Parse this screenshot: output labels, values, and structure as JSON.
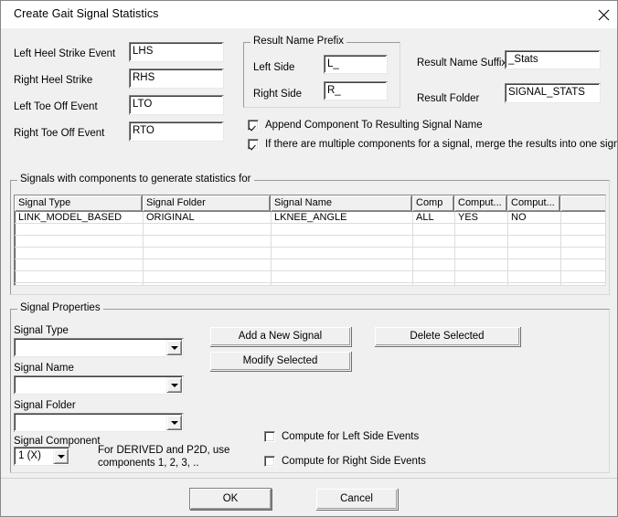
{
  "window": {
    "title": "Create Gait Signal Statistics",
    "close_icon": "close-icon"
  },
  "events": {
    "fields": [
      {
        "label": "Left Heel Strike Event",
        "value": "LHS"
      },
      {
        "label": "Right Heel Strike",
        "value": "RHS"
      },
      {
        "label": "Left Toe Off Event",
        "value": "LTO"
      },
      {
        "label": "Right Toe Off Event",
        "value": "RTO"
      }
    ]
  },
  "result_name_prefix": {
    "title": "Result Name Prefix",
    "left_label": "Left Side",
    "left_value": "L_",
    "right_label": "Right Side",
    "right_value": "R_"
  },
  "result": {
    "suffix_label": "Result Name Suffix",
    "suffix_value": "_Stats",
    "folder_label": "Result Folder",
    "folder_value": "SIGNAL_STATS"
  },
  "options": {
    "append_component": {
      "label": "Append Component To Resulting Signal Name",
      "checked": true
    },
    "merge_components": {
      "label": "If there are multiple components for a signal, merge the results into one signal",
      "checked": true
    }
  },
  "signals_group": {
    "title": "Signals with components to generate statistics for",
    "columns": [
      "Signal Type",
      "Signal Folder",
      "Signal Name",
      "Comp",
      "Comput...",
      "Comput...",
      ""
    ],
    "rows": [
      [
        "LINK_MODEL_BASED",
        "ORIGINAL",
        "LKNEE_ANGLE",
        "ALL",
        "YES",
        "NO",
        ""
      ]
    ],
    "empty_row_count": 6
  },
  "signal_properties": {
    "title": "Signal Properties",
    "signal_type_label": "Signal Type",
    "signal_type_value": "",
    "signal_name_label": "Signal Name",
    "signal_name_value": "",
    "signal_folder_label": "Signal Folder",
    "signal_folder_value": "",
    "signal_component_label": "Signal Component",
    "signal_component_value": "1 (X)",
    "hint_line1": "For DERIVED and P2D, use",
    "hint_line2": "components 1, 2, 3, ..",
    "add_button": "Add a New Signal",
    "modify_button": "Modify Selected",
    "delete_button": "Delete Selected",
    "compute_left": {
      "label": "Compute for Left Side Events",
      "checked": false
    },
    "compute_right": {
      "label": "Compute for Right Side Events",
      "checked": false
    }
  },
  "footer": {
    "ok_label": "OK",
    "cancel_label": "Cancel"
  },
  "colors": {
    "dialog_bg": "#f0f0f0",
    "titlebar_bg": "#ffffff",
    "field_bg": "#ffffff",
    "border": "#868686",
    "text": "#000000"
  }
}
